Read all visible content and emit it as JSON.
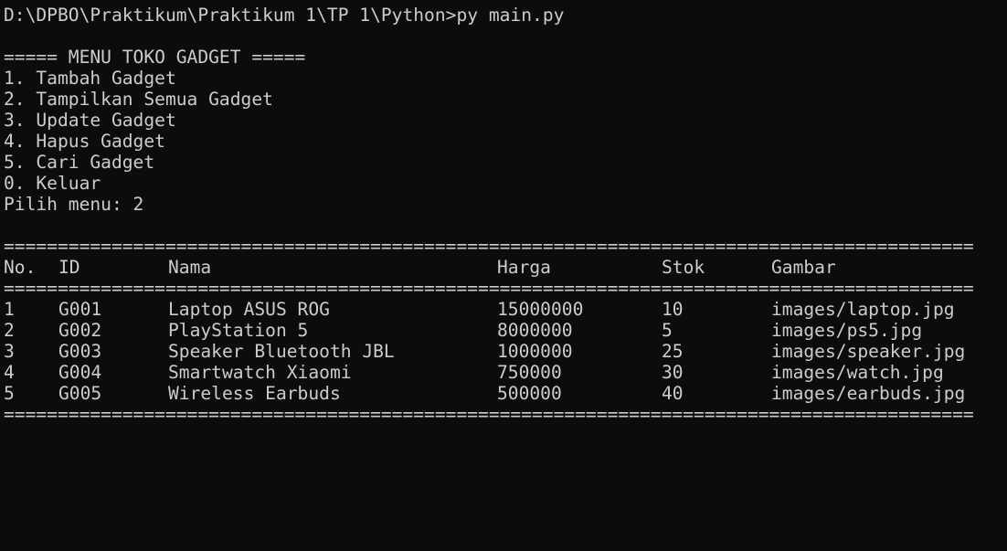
{
  "prompt_line": "D:\\DPBO\\Praktikum\\Praktikum 1\\TP 1\\Python>py main.py",
  "menu": {
    "title": "===== MENU TOKO GADGET =====",
    "items": [
      "1. Tambah Gadget",
      "2. Tampilkan Semua Gadget",
      "3. Update Gadget",
      "4. Hapus Gadget",
      "5. Cari Gadget",
      "0. Keluar"
    ],
    "prompt": "Pilih menu: 2"
  },
  "separator": "==========================================================================================",
  "table": {
    "headers": {
      "no": "No.",
      "id": "ID",
      "nama": "Nama",
      "harga": "Harga",
      "stok": "Stok",
      "gambar": "Gambar"
    },
    "rows": [
      {
        "no": "1",
        "id": "G001",
        "nama": "Laptop ASUS ROG",
        "harga": "15000000",
        "stok": "10",
        "gambar": "images/laptop.jpg"
      },
      {
        "no": "2",
        "id": "G002",
        "nama": "PlayStation 5",
        "harga": "8000000",
        "stok": "5",
        "gambar": "images/ps5.jpg"
      },
      {
        "no": "3",
        "id": "G003",
        "nama": "Speaker Bluetooth JBL",
        "harga": "1000000",
        "stok": "25",
        "gambar": "images/speaker.jpg"
      },
      {
        "no": "4",
        "id": "G004",
        "nama": "Smartwatch Xiaomi",
        "harga": "750000",
        "stok": "30",
        "gambar": "images/watch.jpg"
      },
      {
        "no": "5",
        "id": "G005",
        "nama": "Wireless Earbuds",
        "harga": "500000",
        "stok": "40",
        "gambar": "images/earbuds.jpg"
      }
    ]
  },
  "colors": {
    "background": "#0c0c0c",
    "text": "#cccccc"
  }
}
